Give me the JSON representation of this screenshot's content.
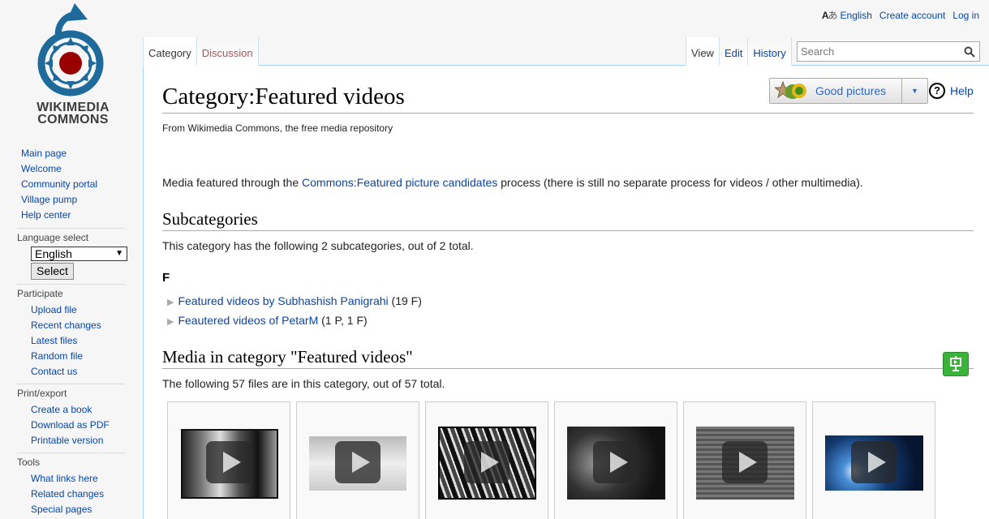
{
  "personal": {
    "language": "English",
    "create_account": "Create account",
    "log_in": "Log in"
  },
  "logo": {
    "line1": "WIKIMEDIA",
    "line2": "COMMONS"
  },
  "sidebar": {
    "navigation": [
      "Main page",
      "Welcome",
      "Community portal",
      "Village pump",
      "Help center"
    ],
    "language_select": {
      "heading": "Language select",
      "selected": "English",
      "button": "Select"
    },
    "participate": {
      "heading": "Participate",
      "items": [
        "Upload file",
        "Recent changes",
        "Latest files",
        "Random file",
        "Contact us"
      ]
    },
    "print_export": {
      "heading": "Print/export",
      "items": [
        "Create a book",
        "Download as PDF",
        "Printable version"
      ]
    },
    "tools": {
      "heading": "Tools",
      "items": [
        "What links here",
        "Related changes",
        "Special pages"
      ]
    }
  },
  "tabs": {
    "category": "Category",
    "discussion": "Discussion",
    "view": "View",
    "edit": "Edit",
    "history": "History"
  },
  "search": {
    "placeholder": "Search"
  },
  "page": {
    "title": "Category:Featured videos",
    "site_sub": "From Wikimedia Commons, the free media repository",
    "gallery_button": "Good pictures",
    "help": "Help",
    "intro_before": "Media featured through the ",
    "intro_link": "Commons:Featured picture candidates",
    "intro_after": " process (there is still no separate process for videos / other multimedia).",
    "subcategories_heading": "Subcategories",
    "subcategories_desc": "This category has the following 2 subcategories, out of 2 total.",
    "letter": "F",
    "subcategories": [
      {
        "name": "Featured videos by Subhashish Panigrahi",
        "count": "(19 F)"
      },
      {
        "name": "Feautered videos of PetarM",
        "count": "(1 P, 1 F)"
      }
    ],
    "media_heading": "Media in category \"Featured videos\"",
    "media_desc": "The following 57 files are in this category, out of 57 total."
  },
  "colors": {
    "link": "#0645ad",
    "new_link": "#a55858",
    "slideshow": "#3bb33b"
  }
}
